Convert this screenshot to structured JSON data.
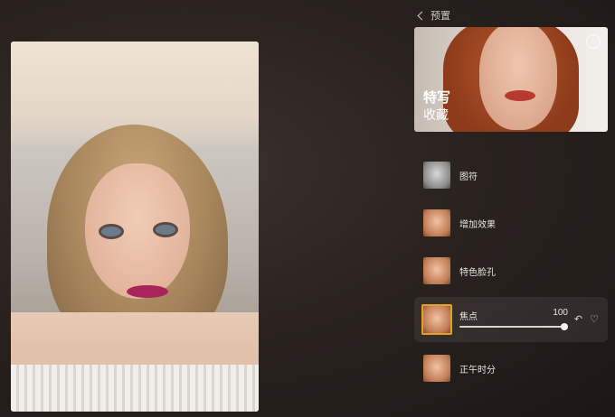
{
  "nav": {
    "back_label": "预置"
  },
  "preview": {
    "title_line1": "特写",
    "title_line2": "收藏",
    "favorite_icon": "heart-outline-icon"
  },
  "presets": [
    {
      "label": "图符",
      "style": "bw"
    },
    {
      "label": "增加效果",
      "style": "color"
    },
    {
      "label": "特色脸孔",
      "style": "color"
    },
    {
      "label": "焦点",
      "style": "color",
      "active": true,
      "value": "100"
    },
    {
      "label": "正午时分",
      "style": "color"
    }
  ],
  "active_actions": {
    "undo_icon": "undo-icon",
    "favorite_icon": "heart-outline-icon"
  },
  "colors": {
    "accent": "#e3a12a",
    "background": "#2a2320"
  }
}
